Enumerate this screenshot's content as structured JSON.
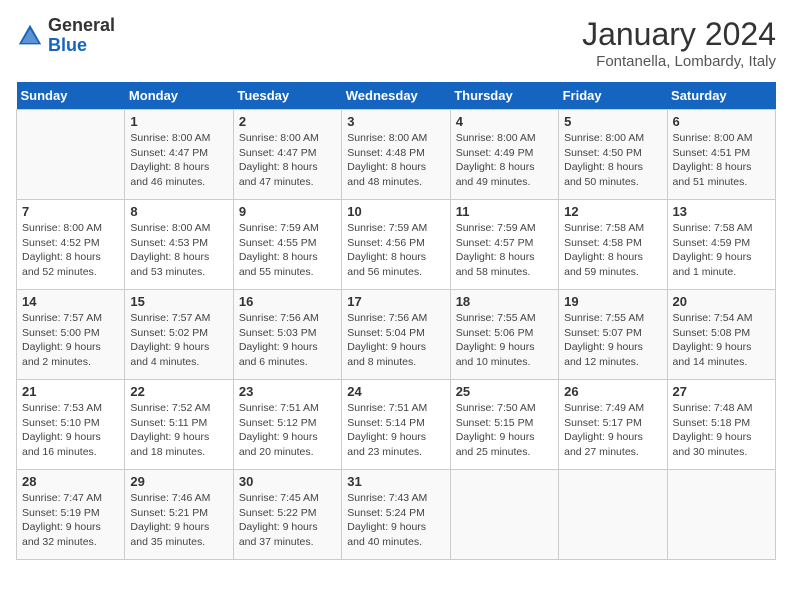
{
  "header": {
    "logo_general": "General",
    "logo_blue": "Blue",
    "calendar_title": "January 2024",
    "calendar_subtitle": "Fontanella, Lombardy, Italy"
  },
  "weekdays": [
    "Sunday",
    "Monday",
    "Tuesday",
    "Wednesday",
    "Thursday",
    "Friday",
    "Saturday"
  ],
  "weeks": [
    [
      {
        "day": "",
        "details": ""
      },
      {
        "day": "1",
        "details": "Sunrise: 8:00 AM\nSunset: 4:47 PM\nDaylight: 8 hours\nand 46 minutes."
      },
      {
        "day": "2",
        "details": "Sunrise: 8:00 AM\nSunset: 4:47 PM\nDaylight: 8 hours\nand 47 minutes."
      },
      {
        "day": "3",
        "details": "Sunrise: 8:00 AM\nSunset: 4:48 PM\nDaylight: 8 hours\nand 48 minutes."
      },
      {
        "day": "4",
        "details": "Sunrise: 8:00 AM\nSunset: 4:49 PM\nDaylight: 8 hours\nand 49 minutes."
      },
      {
        "day": "5",
        "details": "Sunrise: 8:00 AM\nSunset: 4:50 PM\nDaylight: 8 hours\nand 50 minutes."
      },
      {
        "day": "6",
        "details": "Sunrise: 8:00 AM\nSunset: 4:51 PM\nDaylight: 8 hours\nand 51 minutes."
      }
    ],
    [
      {
        "day": "7",
        "details": "Sunrise: 8:00 AM\nSunset: 4:52 PM\nDaylight: 8 hours\nand 52 minutes."
      },
      {
        "day": "8",
        "details": "Sunrise: 8:00 AM\nSunset: 4:53 PM\nDaylight: 8 hours\nand 53 minutes."
      },
      {
        "day": "9",
        "details": "Sunrise: 7:59 AM\nSunset: 4:55 PM\nDaylight: 8 hours\nand 55 minutes."
      },
      {
        "day": "10",
        "details": "Sunrise: 7:59 AM\nSunset: 4:56 PM\nDaylight: 8 hours\nand 56 minutes."
      },
      {
        "day": "11",
        "details": "Sunrise: 7:59 AM\nSunset: 4:57 PM\nDaylight: 8 hours\nand 58 minutes."
      },
      {
        "day": "12",
        "details": "Sunrise: 7:58 AM\nSunset: 4:58 PM\nDaylight: 8 hours\nand 59 minutes."
      },
      {
        "day": "13",
        "details": "Sunrise: 7:58 AM\nSunset: 4:59 PM\nDaylight: 9 hours\nand 1 minute."
      }
    ],
    [
      {
        "day": "14",
        "details": "Sunrise: 7:57 AM\nSunset: 5:00 PM\nDaylight: 9 hours\nand 2 minutes."
      },
      {
        "day": "15",
        "details": "Sunrise: 7:57 AM\nSunset: 5:02 PM\nDaylight: 9 hours\nand 4 minutes."
      },
      {
        "day": "16",
        "details": "Sunrise: 7:56 AM\nSunset: 5:03 PM\nDaylight: 9 hours\nand 6 minutes."
      },
      {
        "day": "17",
        "details": "Sunrise: 7:56 AM\nSunset: 5:04 PM\nDaylight: 9 hours\nand 8 minutes."
      },
      {
        "day": "18",
        "details": "Sunrise: 7:55 AM\nSunset: 5:06 PM\nDaylight: 9 hours\nand 10 minutes."
      },
      {
        "day": "19",
        "details": "Sunrise: 7:55 AM\nSunset: 5:07 PM\nDaylight: 9 hours\nand 12 minutes."
      },
      {
        "day": "20",
        "details": "Sunrise: 7:54 AM\nSunset: 5:08 PM\nDaylight: 9 hours\nand 14 minutes."
      }
    ],
    [
      {
        "day": "21",
        "details": "Sunrise: 7:53 AM\nSunset: 5:10 PM\nDaylight: 9 hours\nand 16 minutes."
      },
      {
        "day": "22",
        "details": "Sunrise: 7:52 AM\nSunset: 5:11 PM\nDaylight: 9 hours\nand 18 minutes."
      },
      {
        "day": "23",
        "details": "Sunrise: 7:51 AM\nSunset: 5:12 PM\nDaylight: 9 hours\nand 20 minutes."
      },
      {
        "day": "24",
        "details": "Sunrise: 7:51 AM\nSunset: 5:14 PM\nDaylight: 9 hours\nand 23 minutes."
      },
      {
        "day": "25",
        "details": "Sunrise: 7:50 AM\nSunset: 5:15 PM\nDaylight: 9 hours\nand 25 minutes."
      },
      {
        "day": "26",
        "details": "Sunrise: 7:49 AM\nSunset: 5:17 PM\nDaylight: 9 hours\nand 27 minutes."
      },
      {
        "day": "27",
        "details": "Sunrise: 7:48 AM\nSunset: 5:18 PM\nDaylight: 9 hours\nand 30 minutes."
      }
    ],
    [
      {
        "day": "28",
        "details": "Sunrise: 7:47 AM\nSunset: 5:19 PM\nDaylight: 9 hours\nand 32 minutes."
      },
      {
        "day": "29",
        "details": "Sunrise: 7:46 AM\nSunset: 5:21 PM\nDaylight: 9 hours\nand 35 minutes."
      },
      {
        "day": "30",
        "details": "Sunrise: 7:45 AM\nSunset: 5:22 PM\nDaylight: 9 hours\nand 37 minutes."
      },
      {
        "day": "31",
        "details": "Sunrise: 7:43 AM\nSunset: 5:24 PM\nDaylight: 9 hours\nand 40 minutes."
      },
      {
        "day": "",
        "details": ""
      },
      {
        "day": "",
        "details": ""
      },
      {
        "day": "",
        "details": ""
      }
    ]
  ]
}
